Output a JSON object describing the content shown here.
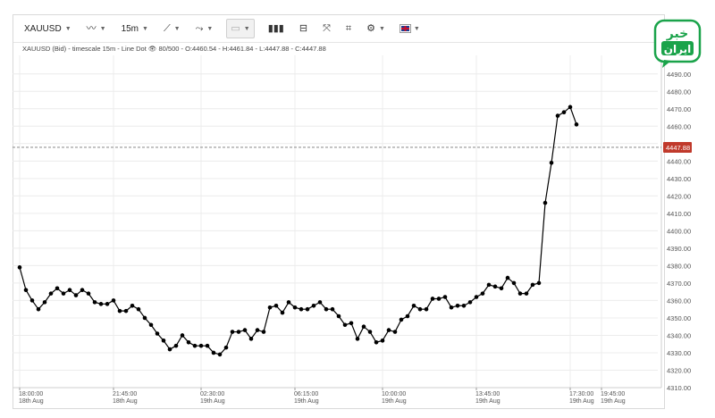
{
  "toolbar": {
    "symbol": "XAUUSD",
    "timeframe": "15m",
    "icons": [
      "line-chart-icon",
      "draw-line-icon",
      "trend-tools-icon",
      "template-icon",
      "indicators-icon",
      "horizontal-line-icon",
      "fullscreen-icon",
      "crop-icon",
      "settings-icon",
      "language-flag-icon"
    ]
  },
  "info_line": "XAUUSD (Bid) - timescale 15m - Line Dot",
  "info_count": "80/500",
  "ohlc": "O:4460.54 - H:4461.84 - L:4447.88 - C:4447.88",
  "logo": {
    "top": "خبر",
    "bottom": "ایران",
    "color": "#1aa34a"
  },
  "current_price": {
    "label": "4447.88",
    "value": 4447.88,
    "color": "#c0392b"
  },
  "chart_data": {
    "type": "line",
    "style": "line-dot",
    "title": "",
    "series": [
      {
        "values": [
          4379,
          4366,
          4360,
          4355,
          4359,
          4364,
          4367,
          4364,
          4366,
          4363,
          4366,
          4364,
          4359,
          4358,
          4358,
          4360,
          4354,
          4354,
          4357,
          4355,
          4350,
          4346,
          4341,
          4337,
          4332,
          4334,
          4340,
          4336,
          4334,
          4334,
          4334,
          4330,
          4329,
          4333,
          4342,
          4342,
          4343,
          4338,
          4343,
          4342,
          4356,
          4357,
          4353,
          4359,
          4356,
          4355,
          4355,
          4357,
          4359,
          4355,
          4355,
          4351,
          4346,
          4347,
          4338,
          4345,
          4342,
          4336,
          4337,
          4343,
          4342,
          4349,
          4351,
          4357,
          4355,
          4355,
          4361,
          4361,
          4362,
          4356,
          4357,
          4357,
          4359,
          4362,
          4364,
          4369,
          4368,
          4367,
          4373,
          4370,
          4364,
          4364,
          4369,
          4370,
          4416,
          4439,
          4466,
          4468,
          4471,
          4461
        ]
      }
    ],
    "y_ticks": [
      4320,
      4330,
      4340,
      4350,
      4360,
      4370,
      4380,
      4390,
      4400,
      4410,
      4420,
      4430,
      4440,
      4450,
      4460,
      4470,
      4480,
      4490
    ],
    "y_tick_labels": [
      "4320.00",
      "4330.00",
      "4340.00",
      "4350.00",
      "4360.00",
      "4370.00",
      "4380.00",
      "4390.00",
      "4400.00",
      "4410.00",
      "4420.00",
      "4430.00",
      "4440.00",
      "4450.00",
      "4460.00",
      "4470.00",
      "4480.00",
      "4490.00"
    ],
    "y_bottom_label": "4310.00",
    "ylim": [
      4310,
      4495
    ],
    "x_ticks": [
      {
        "index": 0,
        "time": "18:00:00",
        "date": "18th Aug"
      },
      {
        "index": 15,
        "time": "21:45:00",
        "date": "18th Aug"
      },
      {
        "index": 29,
        "time": "02:30:00",
        "date": "19th Aug"
      },
      {
        "index": 44,
        "time": "06:15:00",
        "date": "19th Aug"
      },
      {
        "index": 58,
        "time": "10:00:00",
        "date": "19th Aug"
      },
      {
        "index": 73,
        "time": "13:45:00",
        "date": "19th Aug"
      },
      {
        "index": 88,
        "time": "17:30:00",
        "date": "19th Aug"
      },
      {
        "index": 93,
        "time": "19:45:00",
        "date": "19th Aug"
      }
    ],
    "grid": true,
    "colors": {
      "line": "#000000",
      "grid": "#ececec",
      "axis_text": "#555555"
    }
  }
}
